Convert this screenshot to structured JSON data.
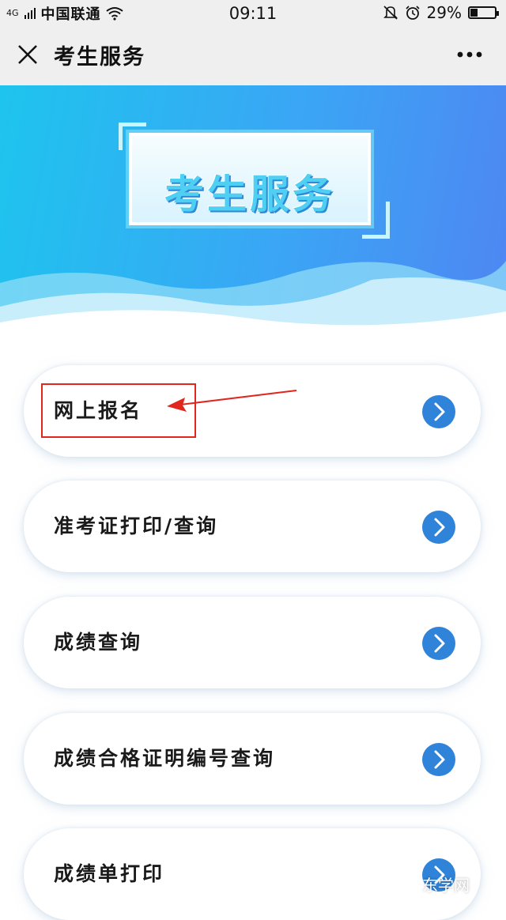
{
  "status_bar": {
    "signal": "4G",
    "carrier": "中国联通",
    "time": "09:11",
    "battery": "29%",
    "battery_level": 0.29
  },
  "header": {
    "title": "考生服务",
    "close_icon": "close-icon",
    "more_icon": "more-icon"
  },
  "banner": {
    "title": "考生服务"
  },
  "menu": {
    "items": [
      {
        "label": "网上报名"
      },
      {
        "label": "准考证打印/查询"
      },
      {
        "label": "成绩查询"
      },
      {
        "label": "成绩合格证明编号查询"
      },
      {
        "label": "成绩单打印"
      }
    ]
  },
  "watermark": "东学网",
  "colors": {
    "accent": "#2f83d9",
    "banner_start": "#1ec4ee",
    "banner_end": "#4f86f2",
    "annotation": "#e0261d"
  }
}
